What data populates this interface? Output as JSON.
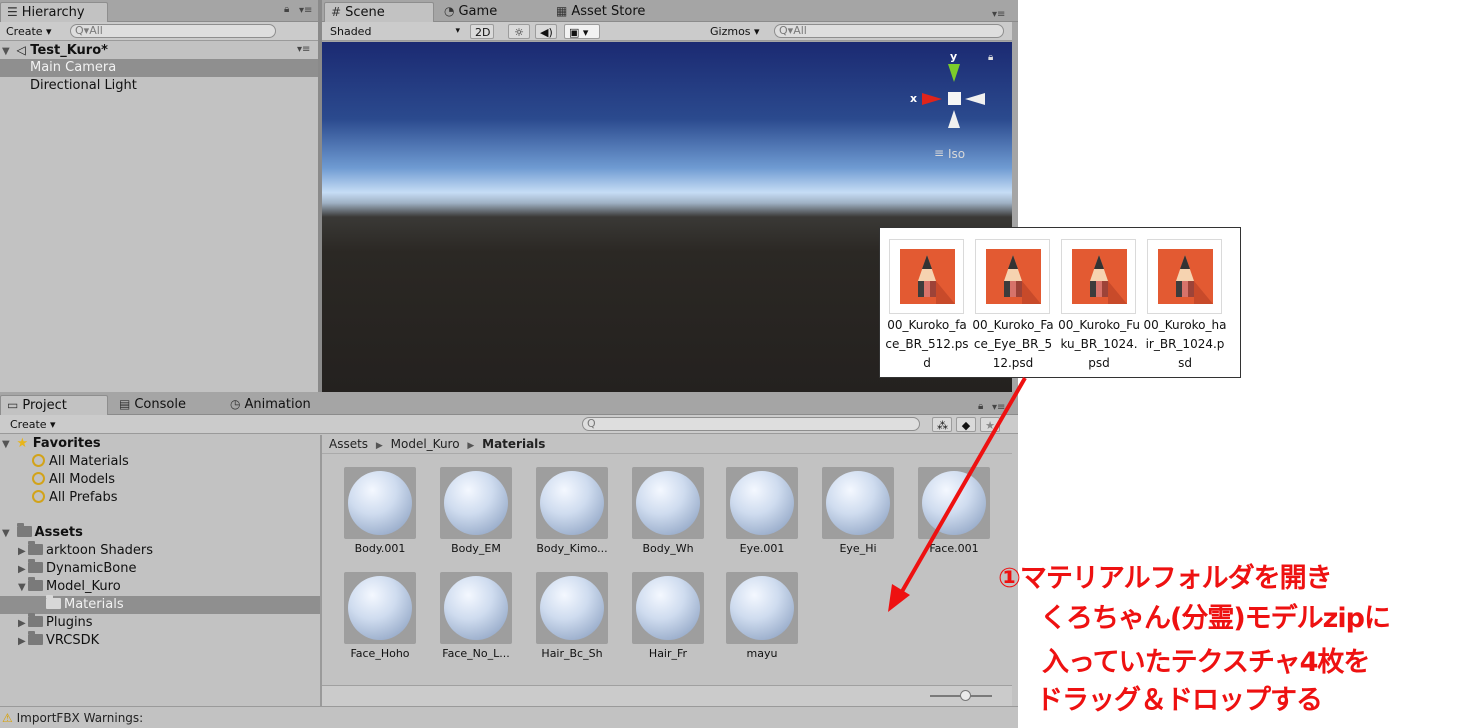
{
  "hierarchy": {
    "tab_label": "Hierarchy",
    "create_label": "Create",
    "search_placeholder": "All",
    "scene_name": "Test_Kuro*",
    "items": [
      "Main Camera",
      "Directional Light"
    ]
  },
  "scene_view": {
    "tabs": [
      "Scene",
      "Game",
      "Asset Store"
    ],
    "shading_mode": "Shaded",
    "mode_2d_label": "2D",
    "gizmos_label": "Gizmos",
    "search_placeholder": "All",
    "axis_y_label": "y",
    "axis_x_label": "x",
    "projection_label": "Iso"
  },
  "project": {
    "tabs": [
      "Project",
      "Console",
      "Animation"
    ],
    "create_label": "Create",
    "favorites": {
      "label": "Favorites",
      "items": [
        "All Materials",
        "All Models",
        "All Prefabs"
      ]
    },
    "assets": {
      "label": "Assets",
      "folders": [
        "arktoon Shaders",
        "DynamicBone",
        "Model_Kuro",
        "Materials",
        "Plugins",
        "VRCSDK"
      ]
    },
    "breadcrumb": [
      "Assets",
      "Model_Kuro",
      "Materials"
    ],
    "materials": [
      "Body.001",
      "Body_EM",
      "Body_Kimo...",
      "Body_Wh",
      "Eye.001",
      "Eye_Hi",
      "Face.001",
      "Face_Hoho",
      "Face_No_L...",
      "Hair_Bc_Sh",
      "Hair_Fr",
      "mayu"
    ]
  },
  "status_bar": {
    "message": "ImportFBX Warnings:"
  },
  "psd_files": [
    "00_Kuroko_face_BR_512.psd",
    "00_Kuroko_Face_Eye_BR_512.psd",
    "00_Kuroko_Fuku_BR_1024.psd",
    "00_Kuroko_hair_BR_1024.psd"
  ],
  "annotation": {
    "lines": [
      "①マテリアルフォルダを開き",
      "くろちゃん(分霊)モデルzipに",
      "入っていたテクスチャ4枚を",
      "ドラッグ＆ドロップする"
    ],
    "color": "#ee1111"
  },
  "colors": {
    "selection": "#8f8f8f",
    "panel": "#c2c2c2",
    "psd_icon": "#e35a32"
  }
}
